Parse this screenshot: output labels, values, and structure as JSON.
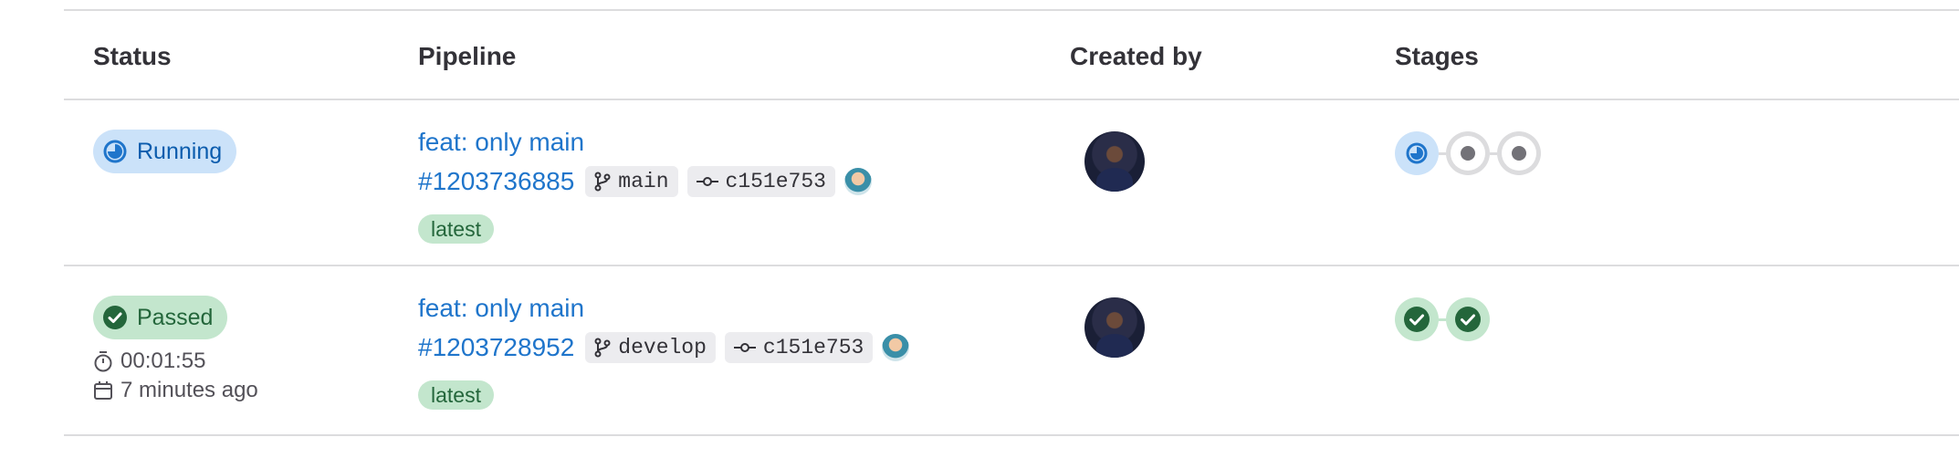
{
  "headers": {
    "status": "Status",
    "pipeline": "Pipeline",
    "created_by": "Created by",
    "stages": "Stages"
  },
  "rows": [
    {
      "status": {
        "label": "Running",
        "icon": "status-running-icon"
      },
      "pipeline": {
        "title": "feat: only main",
        "id": "#1203736885",
        "branch": "main",
        "commit": "c151e753",
        "tag": "latest"
      },
      "creator_avatar": "avatar",
      "stages": [
        "running",
        "created",
        "created"
      ]
    },
    {
      "status": {
        "label": "Passed",
        "icon": "status-success-icon",
        "duration": "00:01:55",
        "finished": "7 minutes ago"
      },
      "pipeline": {
        "title": "feat: only main",
        "id": "#1203728952",
        "branch": "develop",
        "commit": "c151e753",
        "tag": "latest"
      },
      "creator_avatar": "avatar",
      "stages": [
        "success",
        "success"
      ]
    }
  ],
  "colors": {
    "link": "#1f75cb",
    "running_bg": "#cbe2f9",
    "running_fg": "#0b5cad",
    "success_bg": "#c3e6cd",
    "success_fg": "#24663b",
    "border": "#dcdcde"
  }
}
